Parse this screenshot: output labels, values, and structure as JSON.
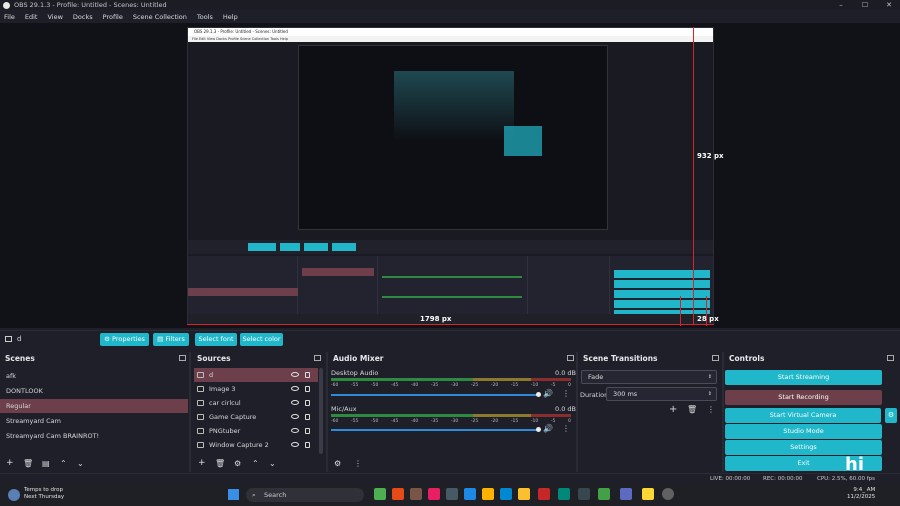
{
  "window": {
    "title": "OBS 29.1.3 - Profile: Untitled - Scenes: Untitled",
    "controls": [
      "–",
      "☐",
      "✕"
    ]
  },
  "menu": [
    "File",
    "Edit",
    "View",
    "Docks",
    "Profile",
    "Scene Collection",
    "Tools",
    "Help"
  ],
  "preview": {
    "nested_title": "OBS 29.1.3 - Profile: Untitled - Scenes: Untitled",
    "nested_menu": "File  Edit  View  Docks  Profile  Scene Collection  Tools  Help",
    "measure_932": "932 px",
    "measure_1798": "1798 px",
    "measure_28": "28 px"
  },
  "source_toolbar": {
    "selected_source": "d",
    "properties_label": "Properties",
    "filters_label": "Filters",
    "select_font_label": "Select font",
    "select_color_label": "Select color"
  },
  "docks": {
    "scenes": "Scenes",
    "sources": "Sources",
    "audio_mixer": "Audio Mixer",
    "scene_transitions": "Scene Transitions",
    "controls": "Controls"
  },
  "scenes": [
    "afk",
    "DONTLOOK",
    "Regular",
    "Streamyard Cam",
    "Streamyard Cam BRAINROT!"
  ],
  "sources": [
    "d",
    "Image 3",
    "car cirlcul",
    "Game Capture",
    "PNGtuber",
    "Window Capture 2"
  ],
  "audio": {
    "desktop_name": "Desktop Audio",
    "desktop_db": "0.0 dB",
    "mic_name": "Mic/Aux",
    "mic_db": "0.0 dB",
    "ticks": [
      "-60",
      "-55",
      "-50",
      "-45",
      "-40",
      "-35",
      "-30",
      "-25",
      "-20",
      "-15",
      "-10",
      "-5",
      "0"
    ]
  },
  "transitions": {
    "selected": "Fade",
    "duration_label": "Duration",
    "duration_value": "300 ms"
  },
  "controls": {
    "start_streaming": "Start Streaming",
    "start_recording": "Start Recording",
    "start_virtual_camera": "Start Virtual Camera",
    "studio_mode": "Studio Mode",
    "settings": "Settings",
    "exit": "Exit"
  },
  "status": {
    "live": "LIVE: 00:00:00",
    "rec": "REC: 00:00:00",
    "cpu": "CPU: 2.5%, 60.00 fps"
  },
  "taskbar": {
    "weather_line1": "Temps to drop",
    "weather_line2": "Next Thursday",
    "search_placeholder": "Search",
    "time": "9:4_ AM",
    "date": "11/2/2025"
  },
  "colors": {
    "accent": "#1fb7c9",
    "selected": "#6c3f4a",
    "measure_red": "#d8232a",
    "background": "#1e1f29"
  }
}
